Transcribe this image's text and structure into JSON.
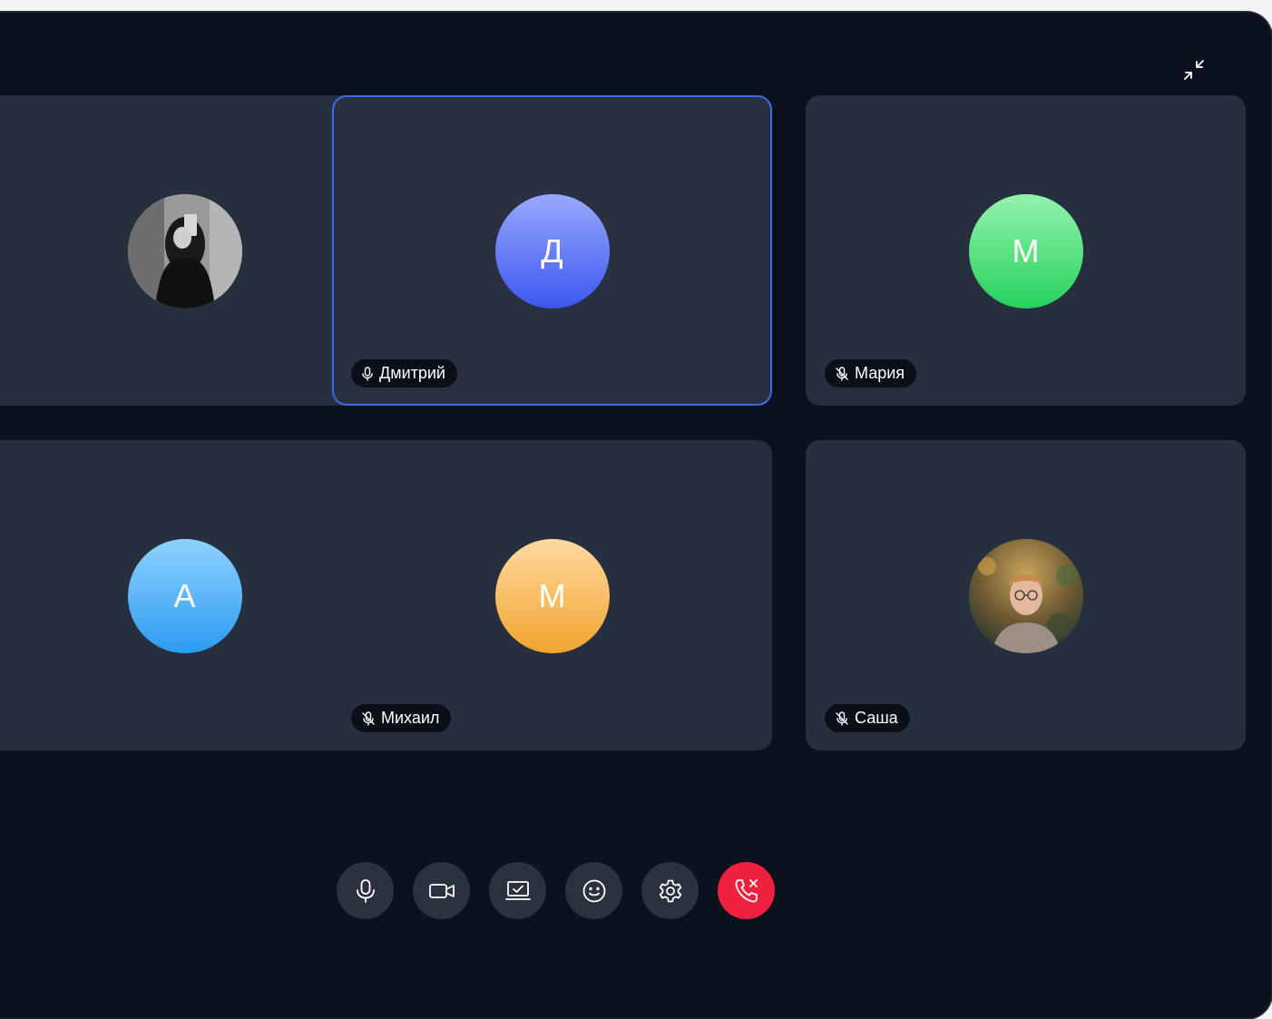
{
  "participants": [
    {
      "name": "",
      "avatar_type": "photo",
      "avatar_desc": "woman-selfie",
      "mic": "none"
    },
    {
      "name": "Дмитрий",
      "initial": "Д",
      "avatar_type": "initial",
      "gradient": [
        "#93a5ff",
        "#3d5af0"
      ],
      "mic": "on",
      "active": true
    },
    {
      "name": "Мария",
      "initial": "М",
      "avatar_type": "initial",
      "gradient": [
        "#8ef0a8",
        "#27d45f"
      ],
      "mic": "muted"
    },
    {
      "name": "",
      "initial": "А",
      "avatar_type": "initial",
      "gradient": [
        "#8cd0ff",
        "#2b9af0"
      ],
      "mic": "none"
    },
    {
      "name": "Михаил",
      "initial": "М",
      "avatar_type": "initial",
      "gradient": [
        "#ffd8a0",
        "#f2a530"
      ],
      "mic": "muted"
    },
    {
      "name": "Саша",
      "avatar_type": "photo",
      "avatar_desc": "man-with-glasses",
      "mic": "muted"
    }
  ],
  "controls": [
    {
      "icon": "microphone-icon"
    },
    {
      "icon": "camera-icon"
    },
    {
      "icon": "screen-share-icon"
    },
    {
      "icon": "emoji-icon"
    },
    {
      "icon": "settings-icon"
    },
    {
      "icon": "end-call-icon",
      "color": "#f0203f"
    }
  ],
  "colors": {
    "background": "#0b111d",
    "tile": "#262f3d",
    "active_border": "#3d67ef",
    "control": "#2a3240"
  }
}
